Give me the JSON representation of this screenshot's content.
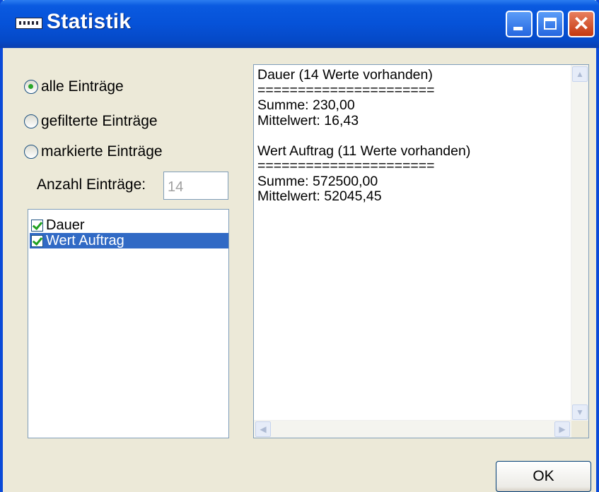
{
  "window": {
    "title": "Statistik"
  },
  "options": {
    "radios": [
      {
        "label": "alle Einträge",
        "checked": true
      },
      {
        "label": "gefilterte Einträge",
        "checked": false
      },
      {
        "label": "markierte Einträge",
        "checked": false
      }
    ],
    "count_label": "Anzahl Einträge:",
    "count_value": "14"
  },
  "fields_list": [
    {
      "label": "Dauer",
      "checked": true,
      "selected": false
    },
    {
      "label": "Wert Auftrag",
      "checked": true,
      "selected": true
    }
  ],
  "output": {
    "text": "Dauer (14 Werte vorhanden)\n======================\nSumme: 230,00\nMittelwert: 16,43\n\nWert Auftrag (11 Werte vorhanden)\n======================\nSumme: 572500,00\nMittelwert: 52045,45"
  },
  "buttons": {
    "ok_label": "OK"
  },
  "colors": {
    "titlebar": "#0652d8",
    "selection": "#316ac5",
    "background": "#ece9d8",
    "close": "#c4380f"
  },
  "icons": [
    "app-icon",
    "minimize-icon",
    "maximize-icon",
    "close-icon",
    "radio-icon",
    "checkbox-icon",
    "scroll-up-icon",
    "scroll-down-icon",
    "scroll-left-icon",
    "scroll-right-icon"
  ]
}
